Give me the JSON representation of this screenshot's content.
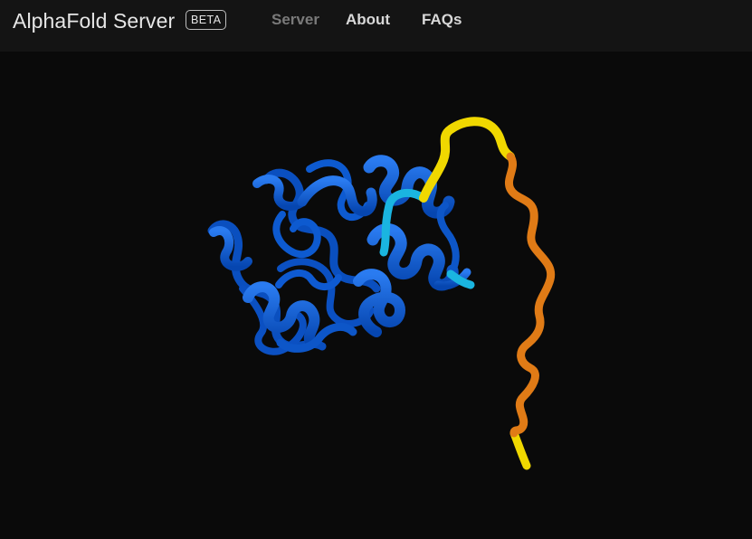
{
  "header": {
    "brand": "AlphaFold Server",
    "badge": "BETA",
    "nav": {
      "server": "Server",
      "about": "About",
      "faqs": "FAQs"
    }
  },
  "colors": {
    "very_high_confidence": "#0a5bd6",
    "confident": "#1ab5e0",
    "low_confidence": "#f0d800",
    "very_low_confidence": "#e07b16",
    "active_nav": "#7a7a7a",
    "nav": "#d8d8d8"
  }
}
